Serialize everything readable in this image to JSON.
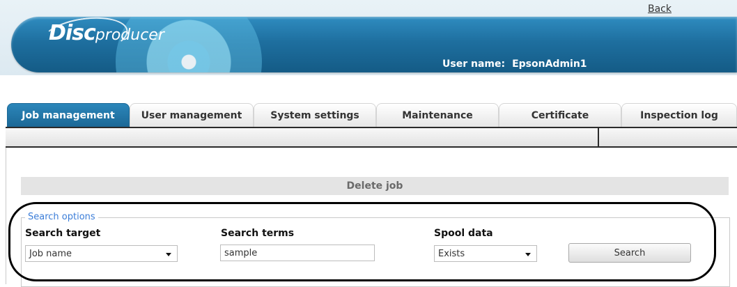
{
  "header": {
    "logo_disc": "Disc",
    "logo_producer": "producer",
    "user_label": "User name:",
    "user_name": "EpsonAdmin1"
  },
  "tabs": [
    {
      "label": "Job management",
      "active": true
    },
    {
      "label": "User management",
      "active": false
    },
    {
      "label": "System settings",
      "active": false
    },
    {
      "label": "Maintenance",
      "active": false
    },
    {
      "label": "Certificate",
      "active": false
    },
    {
      "label": "Inspection log",
      "active": false
    }
  ],
  "toolbar": {
    "back_label": "Back"
  },
  "section": {
    "title": "Delete job"
  },
  "search_options": {
    "legend": "Search options",
    "target_label": "Search target",
    "target_value": "Job name",
    "terms_label": "Search terms",
    "terms_value": "sample",
    "spool_label": "Spool data",
    "spool_value": "Exists",
    "search_button": "Search"
  },
  "colors": {
    "accent": "#1e6f9f",
    "legend": "#3b7dd8"
  }
}
